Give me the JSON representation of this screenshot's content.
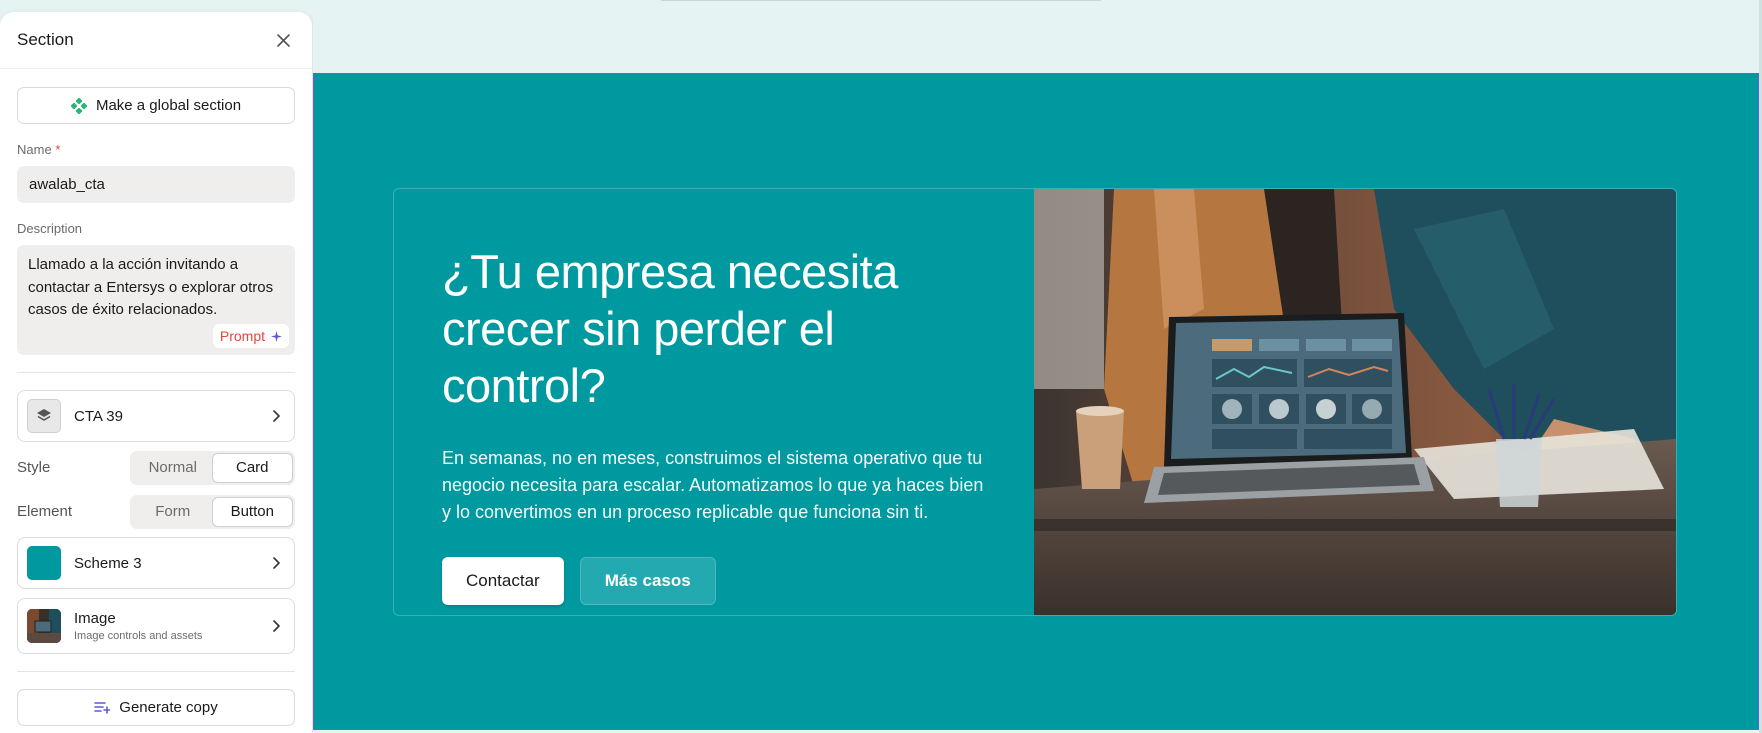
{
  "panel": {
    "title": "Section",
    "global_button_label": "Make a global section",
    "name_label": "Name",
    "name_required_mark": "*",
    "name_value": "awalab_cta",
    "description_label": "Description",
    "description_value": "Llamado a la acción invitando a contactar a Entersys o explorar otros casos de éxito relacionados.",
    "prompt_label": "Prompt",
    "layout_item": "CTA 39",
    "style": {
      "label": "Style",
      "options": [
        "Normal",
        "Card"
      ],
      "selected": "Card"
    },
    "element": {
      "label": "Element",
      "options": [
        "Form",
        "Button"
      ],
      "selected": "Button"
    },
    "scheme": {
      "label": "Scheme 3",
      "color": "#00999f"
    },
    "image": {
      "label": "Image",
      "sublabel": "Image controls and assets"
    },
    "generate_label": "Generate copy"
  },
  "cta": {
    "heading_line1": "¿Tu empresa necesita",
    "heading_line2": "crecer sin perder el control?",
    "body": "En semanas, no en meses, construimos el sistema operativo que tu negocio necesita para escalar. Automatizamos lo que ya haces bien y lo convertimos en un proceso replicable que funciona sin ti.",
    "primary_button": "Contactar",
    "secondary_button": "Más casos"
  },
  "colors": {
    "section_bg": "#00999f",
    "selection_outline": "#6a5cdd",
    "accent_red": "#e0483e",
    "accent_purple": "#5b5bd6",
    "global_icon": "#2bb673"
  },
  "icons": [
    "close-icon",
    "global-section-icon",
    "sparkle-icon",
    "layers-icon",
    "chevron-right-icon",
    "generate-copy-icon"
  ]
}
